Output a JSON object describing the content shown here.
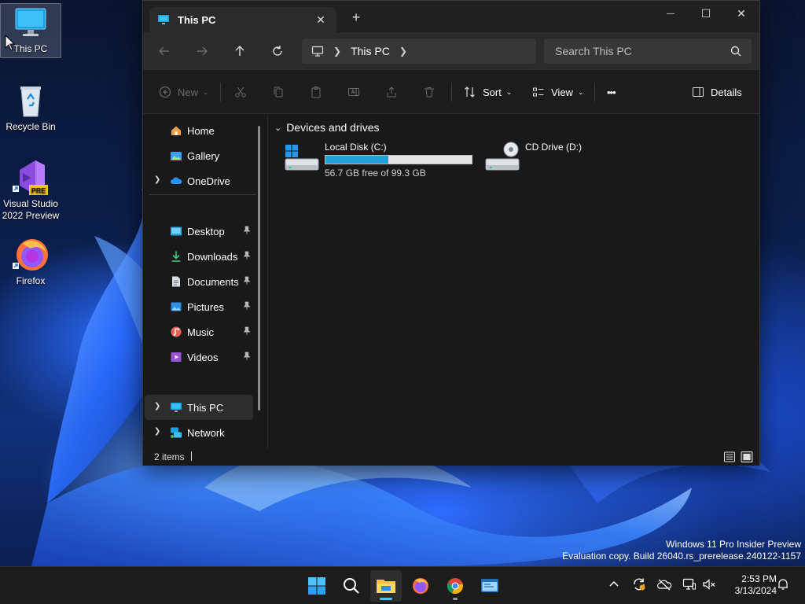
{
  "desktop": {
    "icons": [
      {
        "label": "This PC"
      },
      {
        "label": "Recycle Bin"
      },
      {
        "label": "Visual Studio 2022 Preview",
        "badge": "PRE"
      },
      {
        "label": "Firefox"
      }
    ]
  },
  "window": {
    "tab_title": "This PC",
    "tab_close_glyph": "✕",
    "new_tab_glyph": "+",
    "controls": {
      "minimize": "—",
      "maximize": "☐",
      "close": "✕"
    },
    "address": {
      "location": "This PC"
    },
    "search": {
      "placeholder": "Search This PC"
    },
    "commands": {
      "new_label": "New",
      "sort_label": "Sort",
      "view_label": "View",
      "more_glyph": "•••",
      "details_label": "Details"
    },
    "sidebar": {
      "items": [
        {
          "label": "Home"
        },
        {
          "label": "Gallery"
        },
        {
          "label": "OneDrive"
        },
        {
          "label": "Desktop"
        },
        {
          "label": "Downloads"
        },
        {
          "label": "Documents"
        },
        {
          "label": "Pictures"
        },
        {
          "label": "Music"
        },
        {
          "label": "Videos"
        },
        {
          "label": "This PC"
        },
        {
          "label": "Network"
        }
      ]
    },
    "content": {
      "group_title": "Devices and drives",
      "drives": [
        {
          "name": "Local Disk (C:)",
          "info": "56.7 GB free of 99.3 GB",
          "used_fraction": 0.429
        },
        {
          "name": "CD Drive (D:)"
        }
      ]
    },
    "status": {
      "item_count": "2 items"
    }
  },
  "watermark": {
    "line1": "Windows 11 Pro Insider Preview",
    "line2": "Evaluation copy. Build 26040.rs_prerelease.240122-1157"
  },
  "taskbar": {
    "time": "2:53 PM",
    "date": "3/13/2024"
  },
  "colors": {
    "accent": "#4cc2ff",
    "drive_bar": "#26a0da"
  }
}
